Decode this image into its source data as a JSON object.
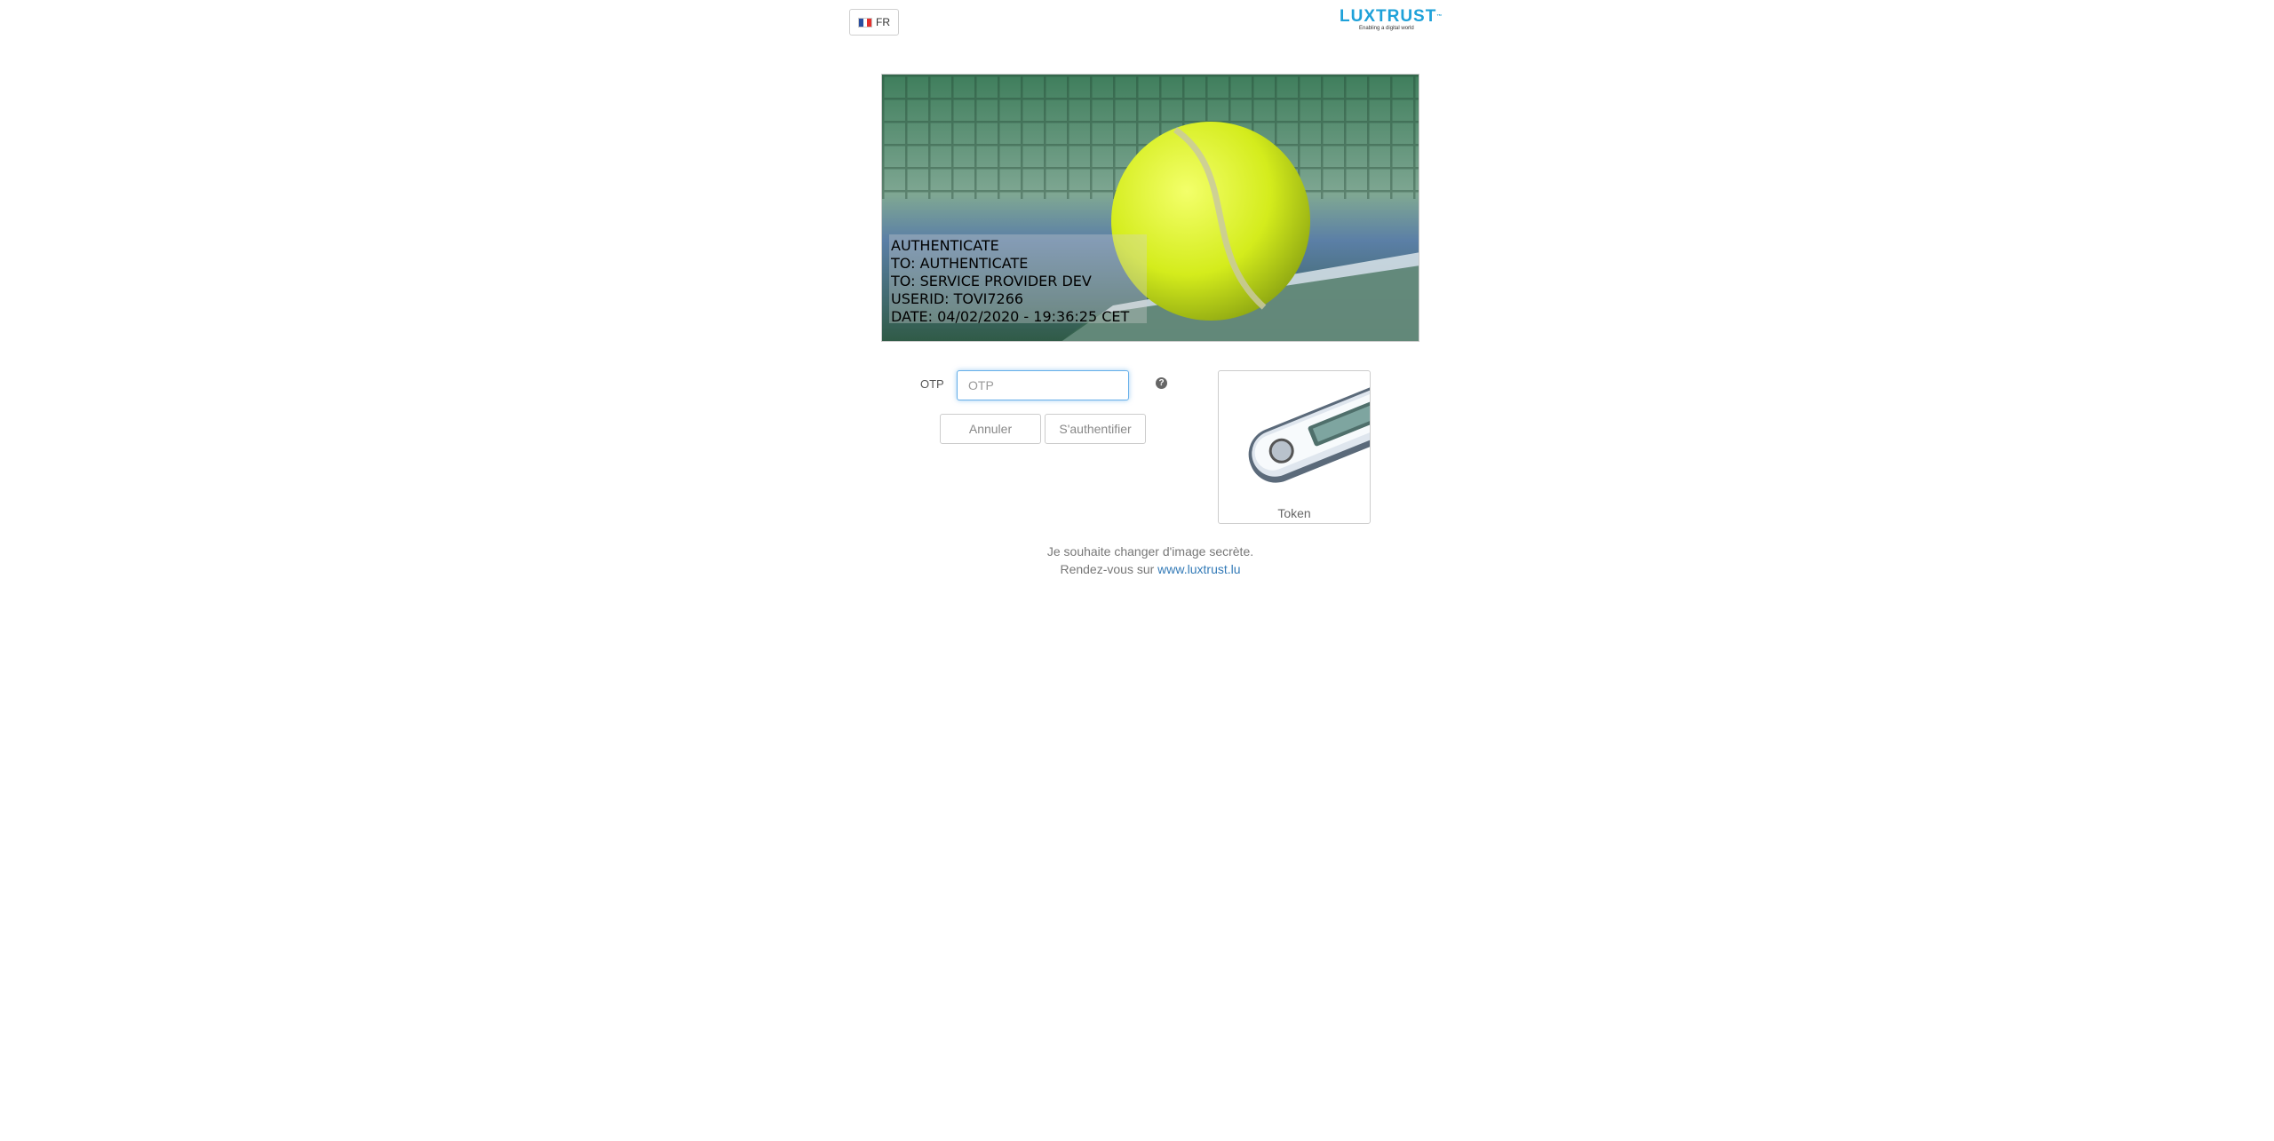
{
  "header": {
    "language": {
      "code": "FR",
      "flag_colors": [
        "#2a4ea0",
        "#ffffff",
        "#e5312e"
      ]
    },
    "logo": {
      "word": "LUXTRUST",
      "trademark": "™",
      "tagline": "Enabling a digital world"
    }
  },
  "secret_image": {
    "subject": "tennis-ball",
    "caption_lines": [
      "AUTHENTICATE",
      "TO: AUTHENTICATE",
      "TO: SERVICE PROVIDER DEV",
      "USERID: TOVI7266",
      "DATE: 04/02/2020 - 19:36:25 CET"
    ]
  },
  "form": {
    "otp_label": "OTP",
    "otp_placeholder": "OTP",
    "otp_value": "",
    "help_icon": "question-circle-icon",
    "cancel_label": "Annuler",
    "submit_label": "S'authentifier"
  },
  "token": {
    "label": "Token"
  },
  "footer": {
    "line1": "Je souhaite changer d'image secrète.",
    "line2_prefix": "Rendez-vous sur",
    "link_text": "www.luxtrust.lu"
  },
  "colors": {
    "accent": "#1ea1d9",
    "link": "#337ab7",
    "focus": "#66afe9"
  }
}
